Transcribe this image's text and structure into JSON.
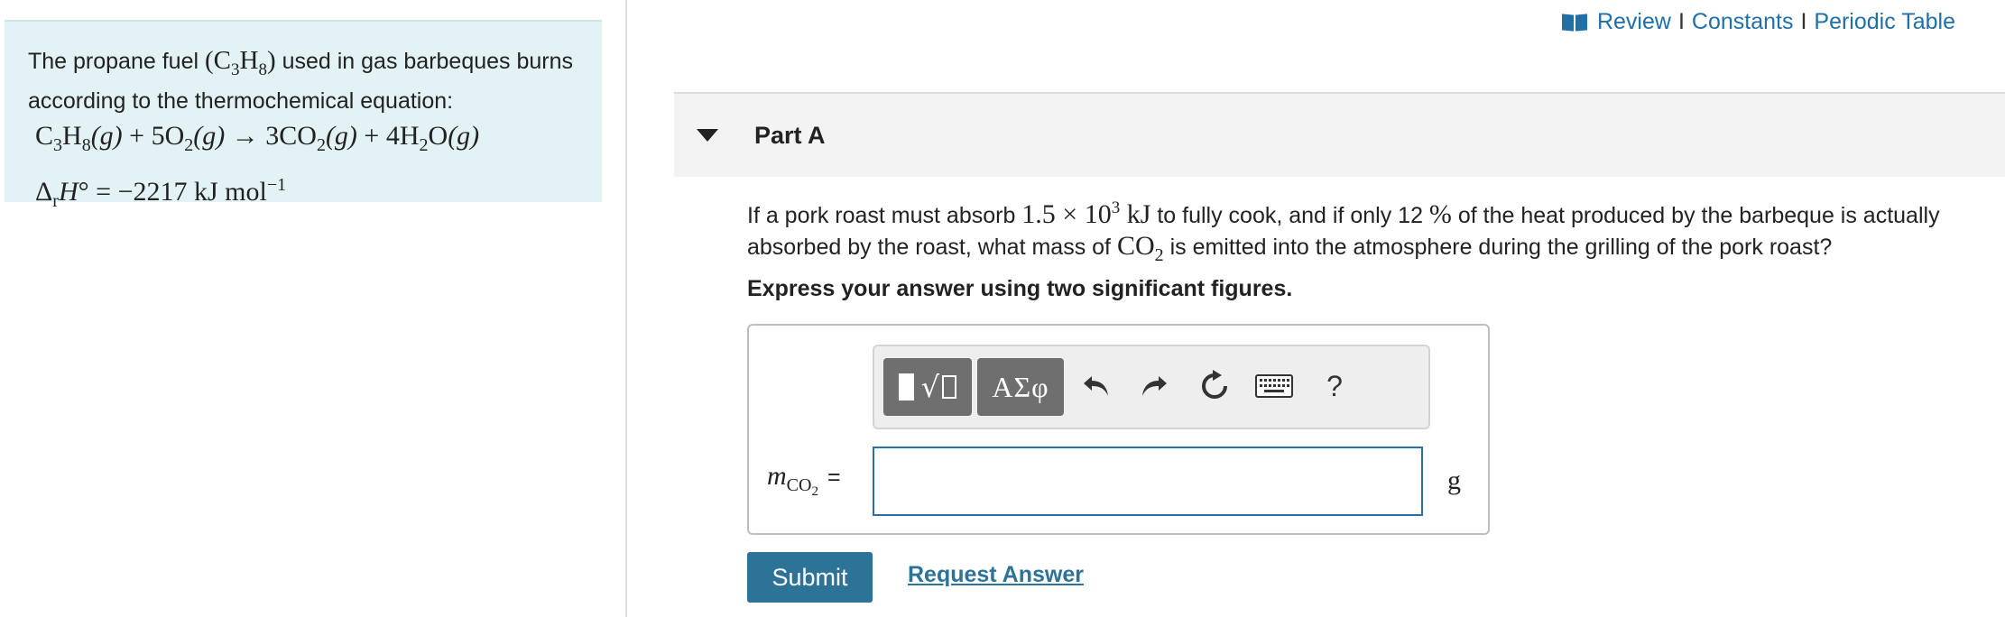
{
  "top_links": {
    "review": "Review",
    "constants": "Constants",
    "periodic_table": "Periodic Table",
    "separator": "I"
  },
  "intro": {
    "text_1": "The propane fuel ",
    "formula_open": "(",
    "formula_close": ")",
    "text_2": " used in gas barbeques burns according to the thermochemical equation:",
    "equation": {
      "reactant_1": "C",
      "reactant_1_sub_a": "3",
      "reactant_1_mid": "H",
      "reactant_1_sub_b": "8",
      "reactant_1_state": "(g)",
      "plus_1": " + ",
      "reactant_2_coef": "5O",
      "reactant_2_sub": "2",
      "reactant_2_state": "(g)",
      "arrow": " → ",
      "product_1_coef": "3CO",
      "product_1_sub": "2",
      "product_1_state": "(g)",
      "plus_2": " + ",
      "product_2_coef": "4H",
      "product_2_sub": "2",
      "product_2_tail": "O",
      "product_2_state": "(g)"
    },
    "enthalpy": {
      "delta": "Δ",
      "r_sub": "r",
      "h": "H",
      "degree": "°",
      "equals": " = ",
      "value": "−2217 kJ mol",
      "exponent": "−1"
    }
  },
  "part": {
    "title": "Part A"
  },
  "question": {
    "text_1": "If a pork roast must absorb ",
    "energy_base": "1.5 × 10",
    "energy_exp": "3",
    "energy_unit": " kJ",
    "text_2": " to fully cook, and if only 12 ",
    "percent": "%",
    "text_3": " of the heat produced by the barbeque is actually absorbed by the roast, what mass of ",
    "co2": "CO",
    "co2_sub": "2",
    "text_4": " is emitted into the atmosphere during the grilling of the pork roast?"
  },
  "instructions": "Express your answer using two significant figures.",
  "toolbar": {
    "greek_label": "ΑΣφ",
    "help_label": "?"
  },
  "answer": {
    "var": "m",
    "var_sub": "CO",
    "var_sub_sub": "2",
    "equals": "=",
    "value": "",
    "unit": "g"
  },
  "actions": {
    "submit": "Submit",
    "request_answer": "Request Answer"
  },
  "colors": {
    "link": "#1f6fa8",
    "submit_bg": "#2d7397",
    "info_panel_bg": "#e3f3f5",
    "input_border": "#2a6fa0"
  }
}
